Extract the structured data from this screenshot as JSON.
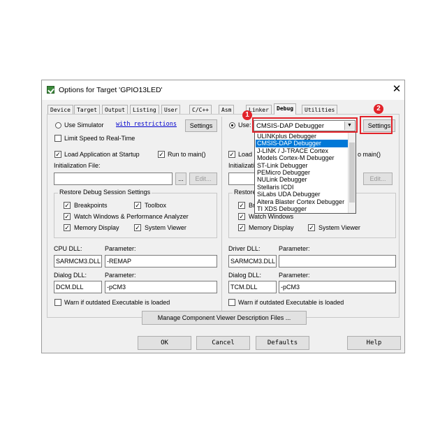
{
  "window": {
    "title": "Options for Target 'GPIO13LED'",
    "close_glyph": "✕"
  },
  "tabs": [
    {
      "label": "Device"
    },
    {
      "label": "Target"
    },
    {
      "label": "Output"
    },
    {
      "label": "Listing"
    },
    {
      "label": "User"
    },
    {
      "label": "C/C++"
    },
    {
      "label": "Asm"
    },
    {
      "label": "Linker"
    },
    {
      "label": "Debug"
    },
    {
      "label": "Utilities"
    }
  ],
  "active_tab": "Debug",
  "left": {
    "use_simulator": "Use Simulator",
    "with_restrictions": "with restrictions",
    "settings_label": "Settings",
    "limit_speed": "Limit Speed to Real-Time",
    "load_app": "Load Application at Startup",
    "run_to_main": "Run to main()",
    "init_file_label": "Initialization File:",
    "init_file_value": "",
    "browse_label": "...",
    "edit_label": "Edit...",
    "restore_title": "Restore Debug Session Settings",
    "breakpoints": "Breakpoints",
    "toolbox": "Toolbox",
    "watch_windows": "Watch Windows & Performance Analyzer",
    "memory_display": "Memory Display",
    "system_viewer": "System Viewer",
    "dll_label": "CPU DLL:",
    "param_label": "Parameter:",
    "dll_value": "SARMCM3.DLL",
    "dll_param": "-REMAP",
    "dialog_dll_label": "Dialog DLL:",
    "dialog_param_label": "Parameter:",
    "dialog_dll_value": "DCM.DLL",
    "dialog_param": "-pCM3",
    "warn_outdated": "Warn if outdated Executable is loaded"
  },
  "right": {
    "use_label": "Use:",
    "debugger_selected": "CMSIS-DAP Debugger",
    "settings_label": "Settings",
    "load_partial": "Load",
    "run_to_main_partial": "o main()",
    "init_file_partial": "Initializati",
    "edit_label": "Edit...",
    "restore_partial": "Restore",
    "breakpoints_partial": "Brea",
    "watch_windows": "Watch Windows",
    "memory_display": "Memory Display",
    "system_viewer": "System Viewer",
    "dll_label": "Driver DLL:",
    "param_label": "Parameter:",
    "dll_value": "SARMCM3.DLL",
    "dll_param": "",
    "dialog_dll_label": "Dialog DLL:",
    "dialog_param_label": "Parameter:",
    "dialog_dll_value": "TCM.DLL",
    "dialog_param": "-pCM3",
    "warn_outdated": "Warn if outdated Executable is loaded"
  },
  "debugger_options": [
    "ULINKplus Debugger",
    "CMSIS-DAP Debugger",
    "J-LINK / J-TRACE Cortex",
    "Models Cortex-M Debugger",
    "ST-Link Debugger",
    "PEMicro Debugger",
    "NULink Debugger",
    "Stellaris ICDI",
    "SiLabs UDA Debugger",
    "Altera Blaster Cortex Debugger",
    "TI XDS Debugger"
  ],
  "highlighted_option_index": 1,
  "manage_component": "Manage Component Viewer Description Files ...",
  "footer": {
    "ok": "OK",
    "cancel": "Cancel",
    "defaults": "Defaults",
    "help": "Help"
  },
  "annotations": {
    "marker1": "1",
    "marker2": "2",
    "color": "#e2232a"
  },
  "icons": {
    "app": "keil-options-icon",
    "dropdown_arrow": "▼",
    "check": "✓"
  }
}
